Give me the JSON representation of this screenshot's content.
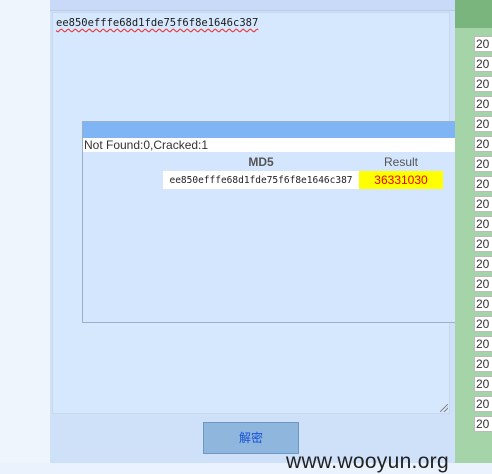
{
  "editor": {
    "hash_input": "ee850efffe68d1fde75f6f8e1646c387"
  },
  "popup": {
    "status": "Not Found:0,Cracked:1",
    "columns": {
      "md5": "MD5",
      "result": "Result"
    },
    "row": {
      "md5": "ee850efffe68d1fde75f6f8e1646c387",
      "result": "36331030"
    }
  },
  "actions": {
    "decrypt_label": "解密"
  },
  "watermark": {
    "site": "www.wooyun.org"
  },
  "side_list": {
    "items": [
      "20",
      "20",
      "20",
      "20",
      "20",
      "20",
      "20",
      "20",
      "20",
      "20",
      "20",
      "20",
      "20",
      "20",
      "20",
      "20",
      "20",
      "20",
      "20",
      "20"
    ]
  }
}
